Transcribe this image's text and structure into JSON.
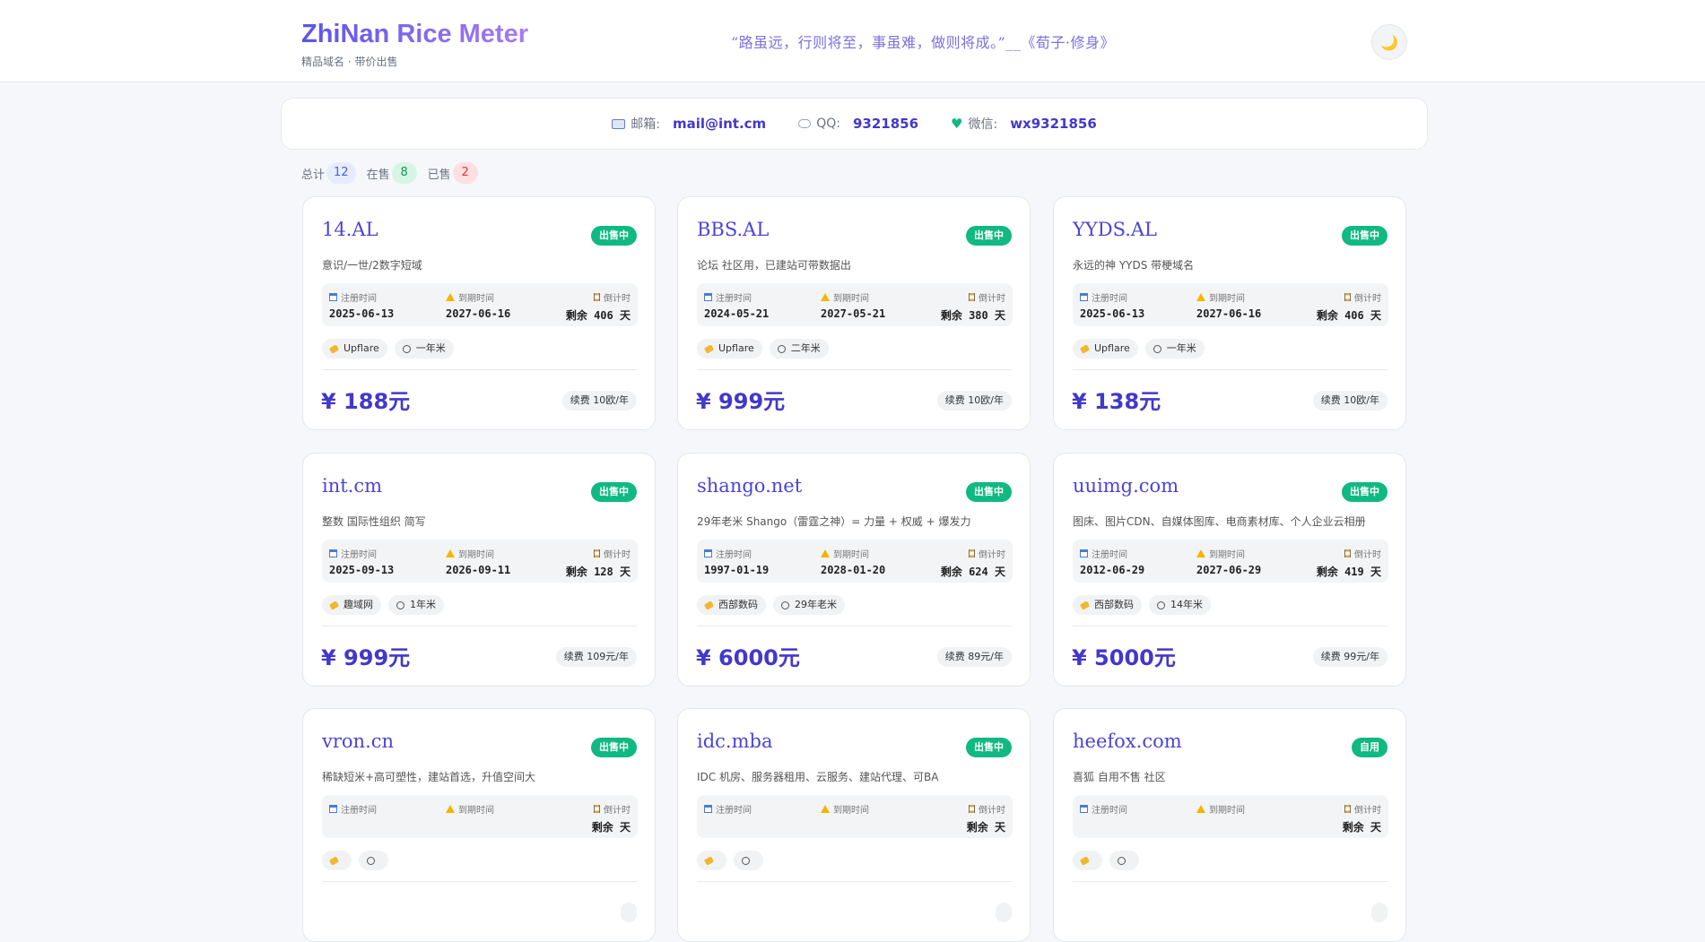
{
  "header": {
    "title": "ZhiNan Rice Meter",
    "subtitle": "精品域名 · 带价出售",
    "quote": "“路虽远，行则将至，事虽难，做则将成。”__《荀子·修身》",
    "theme_icon": "moon-icon",
    "theme_glyph": "🌙"
  },
  "contact": {
    "email_label": "邮箱:",
    "email_value": "mail@int.cm",
    "qq_label": "QQ:",
    "qq_value": "9321856",
    "wechat_label": "微信:",
    "wechat_value": "wx9321856",
    "heart_glyph": "♥"
  },
  "stats": {
    "total_label": "总计",
    "total": "12",
    "onsale_label": "在售",
    "onsale": "8",
    "sold_label": "已售",
    "sold": "2"
  },
  "labels": {
    "reg": "注册时间",
    "exp": "到期时间",
    "countdown": "倒计时",
    "remain_prefix": "剩余",
    "remain_suffix": "天"
  },
  "domains": [
    {
      "name": "14.AL",
      "badge": "出售中",
      "desc": "意识/一世/2数字短域",
      "reg": "2025-06-13",
      "exp": "2027-06-16",
      "days": "406",
      "tag1": "Upflare",
      "tag2": "一年米",
      "price": "¥ 188元",
      "renew": "续费 10欧/年"
    },
    {
      "name": "BBS.AL",
      "badge": "出售中",
      "desc": "论坛 社区用，已建站可带数据出",
      "reg": "2024-05-21",
      "exp": "2027-05-21",
      "days": "380",
      "tag1": "Upflare",
      "tag2": "二年米",
      "price": "¥ 999元",
      "renew": "续费 10欧/年"
    },
    {
      "name": "YYDS.AL",
      "badge": "出售中",
      "desc": "永远的神 YYDS 带梗域名",
      "reg": "2025-06-13",
      "exp": "2027-06-16",
      "days": "406",
      "tag1": "Upflare",
      "tag2": "一年米",
      "price": "¥ 138元",
      "renew": "续费 10欧/年"
    },
    {
      "name": "int.cm",
      "badge": "出售中",
      "desc": "整数 国际性组织 简写",
      "reg": "2025-09-13",
      "exp": "2026-09-11",
      "days": "128",
      "tag1": "趣域网",
      "tag2": "1年米",
      "price": "¥ 999元",
      "renew": "续费 109元/年"
    },
    {
      "name": "shango.net",
      "badge": "出售中",
      "desc": "29年老米 Shango（雷霆之神）= 力量 + 权威 + 爆发力",
      "reg": "1997-01-19",
      "exp": "2028-01-20",
      "days": "624",
      "tag1": "西部数码",
      "tag2": "29年老米",
      "price": "¥ 6000元",
      "renew": "续费 89元/年"
    },
    {
      "name": "uuimg.com",
      "badge": "出售中",
      "desc": "图床、图片CDN、自媒体图库、电商素材库、个人企业云相册",
      "reg": "2012-06-29",
      "exp": "2027-06-29",
      "days": "419",
      "tag1": "西部数码",
      "tag2": "14年米",
      "price": "¥ 5000元",
      "renew": "续费 99元/年"
    },
    {
      "name": "vron.cn",
      "badge": "出售中",
      "desc": "稀缺短米+高可塑性，建站首选，升值空间大",
      "reg": "",
      "exp": "",
      "days": "",
      "tag1": "",
      "tag2": "",
      "price": "",
      "renew": ""
    },
    {
      "name": "idc.mba",
      "badge": "出售中",
      "desc": "IDC 机房、服务器租用、云服务、建站代理、可BA",
      "reg": "",
      "exp": "",
      "days": "",
      "tag1": "",
      "tag2": "",
      "price": "",
      "renew": ""
    },
    {
      "name": "heefox.com",
      "badge": "自用",
      "desc": "喜狐 自用不售 社区",
      "reg": "",
      "exp": "",
      "days": "",
      "tag1": "",
      "tag2": "",
      "price": "",
      "renew": ""
    }
  ]
}
